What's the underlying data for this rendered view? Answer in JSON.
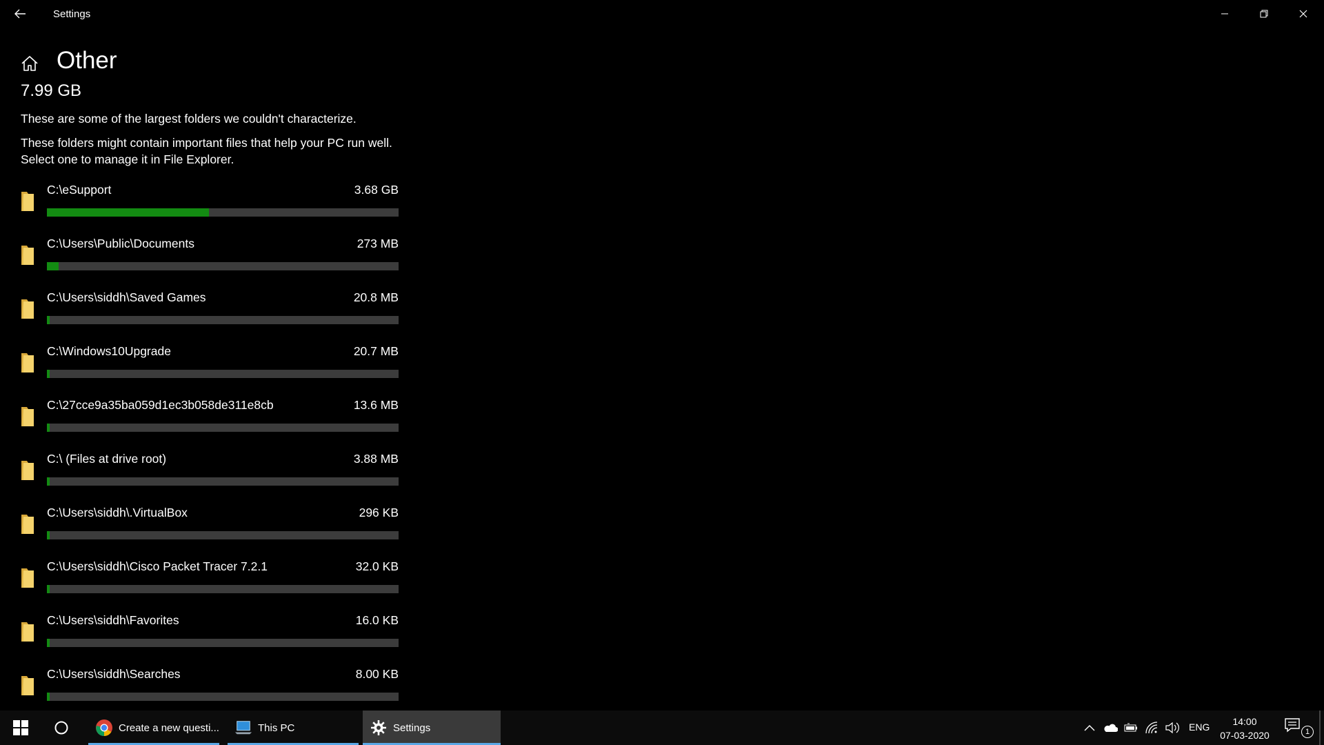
{
  "window": {
    "title": "Settings",
    "back_icon": "back-arrow-icon",
    "controls": [
      "minimize-icon",
      "restore-icon",
      "close-icon"
    ]
  },
  "header": {
    "home_icon": "home-icon",
    "title": "Other",
    "total_size": "7.99 GB",
    "description_1": "These are some of the largest folders we couldn't characterize.",
    "description_2": "These folders might contain important files that help your PC run well. Select one to manage it in File Explorer."
  },
  "colors": {
    "background": "#000000",
    "bar_fill": "#138b12",
    "bar_track": "#3c3c3c",
    "folder_icon": "#f5d36c",
    "taskbar": "#0c0c0c",
    "taskbar_accent": "#5aa8e6"
  },
  "folders": [
    {
      "path": "C:\\eSupport",
      "size": "3.68 GB",
      "usage_fraction": 0.46
    },
    {
      "path": "C:\\Users\\Public\\Documents",
      "size": "273 MB",
      "usage_fraction": 0.034
    },
    {
      "path": "C:\\Users\\siddh\\Saved Games",
      "size": "20.8 MB",
      "usage_fraction": 0.003
    },
    {
      "path": "C:\\Windows10Upgrade",
      "size": "20.7 MB",
      "usage_fraction": 0.003
    },
    {
      "path": "C:\\27cce9a35ba059d1ec3b058de311e8cb",
      "size": "13.6 MB",
      "usage_fraction": 0.002
    },
    {
      "path": "C:\\ (Files at drive root)",
      "size": "3.88 MB",
      "usage_fraction": 0.001
    },
    {
      "path": "C:\\Users\\siddh\\.VirtualBox",
      "size": "296 KB",
      "usage_fraction": 0.0005
    },
    {
      "path": "C:\\Users\\siddh\\Cisco Packet Tracer 7.2.1",
      "size": "32.0 KB",
      "usage_fraction": 0.0003
    },
    {
      "path": "C:\\Users\\siddh\\Favorites",
      "size": "16.0 KB",
      "usage_fraction": 0.0002
    },
    {
      "path": "C:\\Users\\siddh\\Searches",
      "size": "8.00 KB",
      "usage_fraction": 0.0001
    }
  ],
  "taskbar": {
    "start_icon": "windows-start-icon",
    "search_icon": "cortana-circle-icon",
    "apps": [
      {
        "label": "Create a new questi...",
        "icon": "chrome-icon"
      },
      {
        "label": "This PC",
        "icon": "this-pc-icon"
      },
      {
        "label": "Settings",
        "icon": "settings-gear-icon"
      }
    ],
    "tray": {
      "icons": [
        "chevron-up-icon",
        "onedrive-cloud-icon",
        "battery-icon",
        "wifi-icon",
        "volume-icon"
      ],
      "language": "ENG",
      "time": "14:00",
      "date": "07-03-2020",
      "notification_count": "1"
    }
  }
}
